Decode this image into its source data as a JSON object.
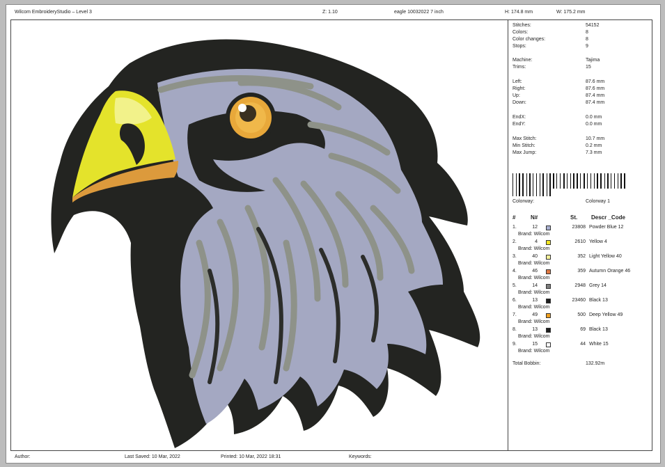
{
  "header": {
    "app": "Wilcom EmbroideryStudio – Level 3",
    "zoom": "Z: 1.10",
    "file": "eagle 10032022 7 inch",
    "height": "H: 174.8 mm",
    "width": "W: 175.2 mm"
  },
  "stats": [
    {
      "label": "Stitches:",
      "value": "54152"
    },
    {
      "label": "Colors:",
      "value": "8"
    },
    {
      "label": "Color changes:",
      "value": "8"
    },
    {
      "label": "Stops:",
      "value": "9"
    },
    {
      "label": "Machine:",
      "value": "Tajima"
    },
    {
      "label": "Trims:",
      "value": "15"
    },
    {
      "label": "Left:",
      "value": "87.6 mm"
    },
    {
      "label": "Right:",
      "value": "87.6 mm"
    },
    {
      "label": "Up:",
      "value": "87.4 mm"
    },
    {
      "label": "Down:",
      "value": "87.4 mm"
    },
    {
      "label": "EndX:",
      "value": "0.0 mm"
    },
    {
      "label": "EndY:",
      "value": "0.0 mm"
    },
    {
      "label": "Max Stitch:",
      "value": "10.7 mm"
    },
    {
      "label": "Min Stitch:",
      "value": "0.2 mm"
    },
    {
      "label": "Max Jump:",
      "value": "7.3 mm"
    }
  ],
  "colorway": {
    "label": "Colorway:",
    "value": "Colorway 1"
  },
  "table": {
    "headers": {
      "idx": "#",
      "num": "N#",
      "st": "St.",
      "desc": "Descr _Code"
    },
    "rows": [
      {
        "idx": "1.",
        "num": "12",
        "color": "#a9b0d0",
        "st": "23808",
        "desc": "Powder Blue 12",
        "brand": "Brand: Wilcom"
      },
      {
        "idx": "2.",
        "num": "4",
        "color": "#f3e622",
        "st": "2610",
        "desc": "Yellow 4",
        "brand": "Brand: Wilcom"
      },
      {
        "idx": "3.",
        "num": "40",
        "color": "#f5f19a",
        "st": "352",
        "desc": "Light Yellow 40",
        "brand": "Brand: Wilcom"
      },
      {
        "idx": "4.",
        "num": "46",
        "color": "#e07a45",
        "st": "359",
        "desc": "Autumn Orange 46",
        "brand": "Brand: Wilcom"
      },
      {
        "idx": "5.",
        "num": "14",
        "color": "#7e7e7e",
        "st": "2948",
        "desc": "Grey 14",
        "brand": "Brand: Wilcom"
      },
      {
        "idx": "6.",
        "num": "13",
        "color": "#1e1e1e",
        "st": "23460",
        "desc": "Black 13",
        "brand": "Brand: Wilcom"
      },
      {
        "idx": "7.",
        "num": "49",
        "color": "#f0a020",
        "st": "500",
        "desc": "Deep Yellow 49",
        "brand": "Brand: Wilcom"
      },
      {
        "idx": "8.",
        "num": "13",
        "color": "#1e1e1e",
        "st": "69",
        "desc": "Black 13",
        "brand": "Brand: Wilcom"
      },
      {
        "idx": "9.",
        "num": "15",
        "color": "#ffffff",
        "st": "44",
        "desc": "White 15",
        "brand": "Brand: Wilcom"
      }
    ]
  },
  "bobbin": {
    "label": "Total Bobbin:",
    "value": "132.92m"
  },
  "footer": {
    "author": "Author:",
    "saved": "Last Saved: 10 Mar, 2022",
    "printed": "Printed: 10 Mar, 2022 18:31",
    "keywords": "Keywords:"
  }
}
